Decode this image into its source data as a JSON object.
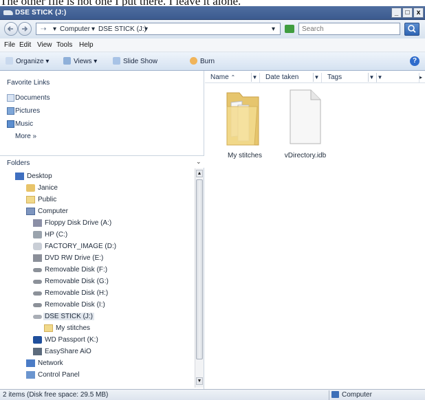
{
  "caption": "The other file is not one I put there. I leave it alone.",
  "window": {
    "title": "DSE STICK (J:)",
    "minimize": "_",
    "maximize": "□",
    "close": "x"
  },
  "address": {
    "crumbs": [
      "Computer",
      "DSE STICK (J:)"
    ],
    "search_placeholder": "Search"
  },
  "menu": [
    "File",
    "Edit",
    "View",
    "Tools",
    "Help"
  ],
  "toolbar": {
    "organize": "Organize",
    "views": "Views",
    "slideshow": "Slide Show",
    "burn": "Burn",
    "help": "?"
  },
  "favorites": {
    "title": "Favorite Links",
    "items": [
      "Documents",
      "Pictures",
      "Music"
    ],
    "more": "More »"
  },
  "folders": {
    "title": "Folders",
    "tree": [
      {
        "label": "Desktop",
        "icon": "desktop-icon"
      },
      {
        "label": "Janice",
        "icon": "user-folder-icon"
      },
      {
        "label": "Public",
        "icon": "folder-icon"
      },
      {
        "label": "Computer",
        "icon": "computer-icon"
      },
      {
        "label": "Floppy Disk Drive (A:)",
        "icon": "floppy-icon"
      },
      {
        "label": "HP (C:)",
        "icon": "hard-drive-icon"
      },
      {
        "label": "FACTORY_IMAGE (D:)",
        "icon": "drive-icon"
      },
      {
        "label": "DVD RW Drive (E:)",
        "icon": "dvd-drive-icon"
      },
      {
        "label": "Removable Disk (F:)",
        "icon": "removable-disk-icon"
      },
      {
        "label": "Removable Disk (G:)",
        "icon": "removable-disk-icon"
      },
      {
        "label": "Removable Disk (H:)",
        "icon": "removable-disk-icon"
      },
      {
        "label": "Removable Disk (I:)",
        "icon": "removable-disk-icon"
      },
      {
        "label": "DSE STICK (J:)",
        "icon": "usb-drive-icon",
        "selected": true
      },
      {
        "label": "My stitches",
        "icon": "folder-icon"
      },
      {
        "label": "WD Passport (K:)",
        "icon": "wd-drive-icon"
      },
      {
        "label": "EasyShare AiO",
        "icon": "scanner-icon"
      },
      {
        "label": "Network",
        "icon": "network-icon"
      },
      {
        "label": "Control Panel",
        "icon": "control-panel-icon"
      }
    ]
  },
  "columns": [
    "Name",
    "Date taken",
    "Tags"
  ],
  "files": [
    {
      "name": "My stitches",
      "icon": "folder-icon"
    },
    {
      "name": "vDirectory.idb",
      "icon": "file-icon"
    }
  ],
  "status": {
    "summary": "2 items (Disk free space: 29.5 MB)",
    "zone": "Computer"
  },
  "colors": {
    "titlebar": "#3c5b8f",
    "folder": "#f1d98a",
    "selection": "#e2e7ee"
  }
}
